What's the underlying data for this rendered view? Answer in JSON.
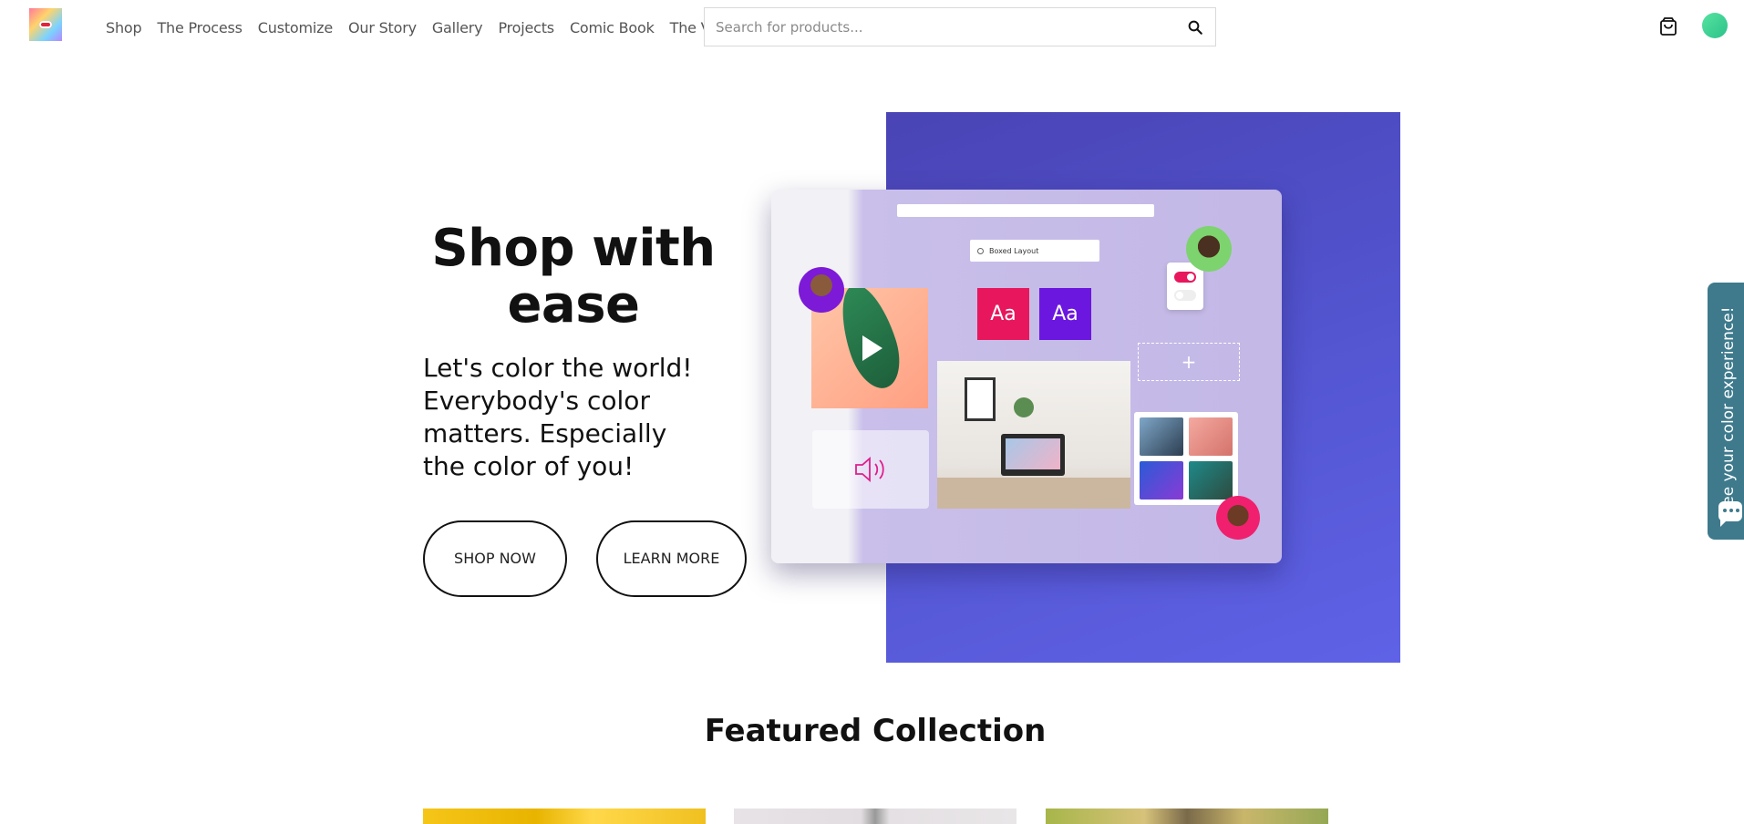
{
  "header": {
    "nav": [
      "Shop",
      "The Process",
      "Customize",
      "Our Story",
      "Gallery",
      "Projects",
      "Comic Book",
      "The Village"
    ],
    "search_placeholder": "Search for products...",
    "icons": {
      "search": "search-icon",
      "cart": "cart-icon",
      "avatar": "user-avatar"
    }
  },
  "hero": {
    "title": "Shop with ease",
    "subtitle": "Let's color the world! Everybody's color matters. Especially the color of you!",
    "buttons": {
      "shop": "SHOP NOW",
      "learn": "LEARN MORE"
    },
    "mock": {
      "search_text": "Boxed Layout",
      "tile_a": "Aa",
      "tile_b": "Aa",
      "plus": "+"
    },
    "colors": {
      "art_background": "#5254cf",
      "tile_pink": "#e8175d",
      "tile_purple": "#6b17e0"
    }
  },
  "featured": {
    "title": "Featured Collection"
  },
  "side_tab": {
    "label": "See your color experience!"
  }
}
